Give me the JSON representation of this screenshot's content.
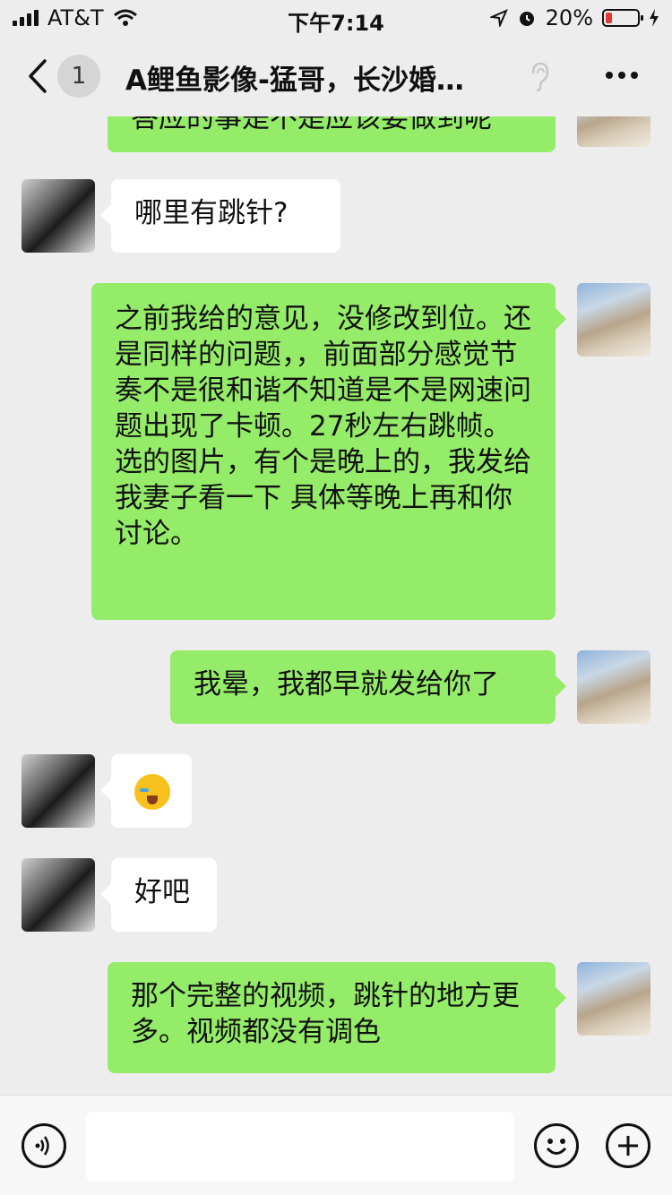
{
  "status_bar": {
    "carrier": "AT&T",
    "time": "下午7:14",
    "battery_percent": "20%",
    "battery_level": 0.2,
    "battery_color": "#e53935"
  },
  "nav": {
    "back_icon": "chevron-left-icon",
    "unread_count": "1",
    "title": "A鲤鱼影像-猛哥，长沙婚…",
    "ear_icon": "ear-icon",
    "more_icon": "more-icon"
  },
  "messages": [
    {
      "side": "out",
      "text": "答应的事是不是应该要做到呢"
    },
    {
      "side": "in",
      "text": "哪里有跳针?"
    },
    {
      "side": "out",
      "text": "之前我给的意见，没修改到位。还是同样的问题，，前面部分感觉节奏不是很和谐不知道是不是网速问题出现了卡顿。27秒左右跳帧。选的图片，有个是晚上的，我发给我妻子看一下 具体等晚上再和你讨论。"
    },
    {
      "side": "out",
      "text": "我晕，我都早就发给你了"
    },
    {
      "side": "in",
      "emoji": "crying-face-emoji"
    },
    {
      "side": "in",
      "text": "好吧"
    },
    {
      "side": "out",
      "text": "那个完整的视频，跳针的地方更多。视频都没有调色"
    }
  ],
  "input_bar": {
    "voice_icon": "voice-icon",
    "input_value": "",
    "emoji_icon": "smiley-icon",
    "plus_icon": "plus-icon"
  },
  "colors": {
    "outgoing_bubble": "#95ec69",
    "incoming_bubble": "#ffffff",
    "chat_background": "#ededed"
  }
}
